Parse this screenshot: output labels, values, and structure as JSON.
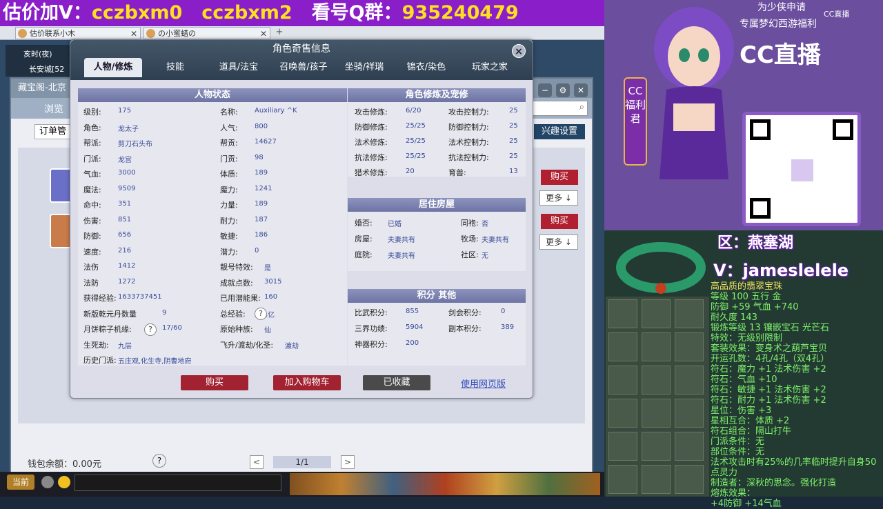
{
  "banner": {
    "prefix": "估价加V：",
    "v1": "cczbxm0",
    "v2": "cczbxm2",
    "qlabel": "看号Q群：",
    "qnum": "935240479"
  },
  "browser_tabs": [
    {
      "label": "估价联系小木"
    },
    {
      "label": "の小蜜蜡の"
    }
  ],
  "game": {
    "time": "亥时(夜)",
    "city": "长安城[52"
  },
  "bg_window": {
    "title": "藏宝阁-北京",
    "nav": "浏览",
    "order": "订单管",
    "interest": "兴趣设置",
    "buy": "购买",
    "more": "更多 ↓",
    "wallet": "钱包余额：0.00元",
    "help": "?",
    "page": "1/1",
    "prev": "<",
    "next": ">"
  },
  "dialog": {
    "title": "角色奇售信息",
    "close": "×",
    "tabs": [
      "人物/修炼",
      "技能",
      "道具/法宝",
      "召唤兽/孩子",
      "坐骑/祥瑞",
      "锦衣/染色",
      "玩家之家"
    ],
    "status_title": "人物状态",
    "status_left": [
      {
        "k": "级别:",
        "v": "175"
      },
      {
        "k": "角色:",
        "v": "龙太子"
      },
      {
        "k": "帮派:",
        "v": "剪刀石头布"
      },
      {
        "k": "门派:",
        "v": "龙宫"
      },
      {
        "k": "气血:",
        "v": "3000"
      },
      {
        "k": "魔法:",
        "v": "9509"
      },
      {
        "k": "命中:",
        "v": "351"
      },
      {
        "k": "伤害:",
        "v": "851"
      },
      {
        "k": "防御:",
        "v": "656"
      },
      {
        "k": "速度:",
        "v": "216"
      },
      {
        "k": "法伤",
        "v": "1412"
      },
      {
        "k": "法防",
        "v": "1272"
      },
      {
        "k": "获得经验:",
        "v": "1633737451"
      },
      {
        "k": "新版乾元丹数量",
        "v": "9"
      },
      {
        "k": "月饼粽子机缘:",
        "v": "17/60"
      },
      {
        "k": "生死劫:",
        "v": "九层"
      },
      {
        "k": "历史门派:",
        "v": "五庄观,化生寺,阴曹地府"
      }
    ],
    "status_right": [
      {
        "k": "名称:",
        "v": "Auxiliary ^K"
      },
      {
        "k": "人气:",
        "v": "800"
      },
      {
        "k": "帮贡:",
        "v": "14627"
      },
      {
        "k": "门贡:",
        "v": "98"
      },
      {
        "k": "体质:",
        "v": "189"
      },
      {
        "k": "魔力:",
        "v": "1241"
      },
      {
        "k": "力量:",
        "v": "189"
      },
      {
        "k": "耐力:",
        "v": "187"
      },
      {
        "k": "敏捷:",
        "v": "186"
      },
      {
        "k": "潜力:",
        "v": "0"
      },
      {
        "k": "靓号特效:",
        "v": "是"
      },
      {
        "k": "成就点数:",
        "v": "3015"
      },
      {
        "k": "已用潜能果:",
        "v": "160"
      },
      {
        "k": "总经验:",
        "v": "294亿"
      },
      {
        "k": "原始种族:",
        "v": "仙"
      },
      {
        "k": "飞升/渡劫/化圣:",
        "v": "渡劫"
      }
    ],
    "cult_title": "角色修炼及宠修",
    "cult_left": [
      {
        "k": "攻击修炼:",
        "v": "6/20"
      },
      {
        "k": "防御修炼:",
        "v": "25/25"
      },
      {
        "k": "法术修炼:",
        "v": "25/25"
      },
      {
        "k": "抗法修炼:",
        "v": "25/25"
      },
      {
        "k": "猎术修炼:",
        "v": "20"
      }
    ],
    "cult_right": [
      {
        "k": "攻击控制力:",
        "v": "25"
      },
      {
        "k": "防御控制力:",
        "v": "25"
      },
      {
        "k": "法术控制力:",
        "v": "25"
      },
      {
        "k": "抗法控制力:",
        "v": "25"
      },
      {
        "k": "育兽:",
        "v": "13"
      }
    ],
    "house_title": "居住房屋",
    "house": [
      {
        "k": "婚否:",
        "v": "已婚"
      },
      {
        "k": "同袍:",
        "v": "否"
      },
      {
        "k": "房屋:",
        "v": "夫妻共有"
      },
      {
        "k": "牧场:",
        "v": "夫妻共有"
      },
      {
        "k": "庭院:",
        "v": "夫妻共有"
      },
      {
        "k": "社区:",
        "v": "无"
      }
    ],
    "score_title": "积分 其他",
    "score": [
      {
        "k": "比武积分:",
        "v": "855"
      },
      {
        "k": "剑会积分:",
        "v": "0"
      },
      {
        "k": "三界功绩:",
        "v": "5904"
      },
      {
        "k": "副本积分:",
        "v": "389"
      },
      {
        "k": "神器积分:",
        "v": "200"
      }
    ],
    "buttons": {
      "buy": "购买",
      "cart": "加入购物车",
      "fav": "已收藏",
      "web": "使用网页版"
    }
  },
  "taskbar": {
    "start": "当前"
  },
  "right_panel": {
    "line1": "为少侠申请",
    "line2": "专属梦幻西游福利",
    "brand": "CC直播",
    "brand_small": "CC直播",
    "board": "CC福利君",
    "zone": "区：燕塞湖",
    "vid": "V：jameslelele",
    "stats": [
      "高品质的翡翠宝珠",
      "等级 100  五行 金",
      "防御 +59 气血 +740",
      "耐久度 143",
      "锻炼等级 13  镶嵌宝石 光芒石",
      "特效：无级别限制",
      "套装效果：变身术之葫芦宝贝",
      "开运孔数：4孔/4孔（双4孔）",
      "符石：魔力 +1 法术伤害 +2",
      "符石：气血 +10",
      "符石：敏捷 +1 法术伤害 +2",
      "符石：耐力 +1 法术伤害 +2",
      "星位：伤害 +3",
      "星相互合：体质 +2",
      "符石组合：隔山打牛",
      "门派条件：无",
      "部位条件：无",
      "法术攻击时有25%的几率临时提升自身50点灵力",
      "制造者：深秋的思念。强化打造",
      "熔炼效果：",
      "+4防御 +14气血"
    ]
  }
}
